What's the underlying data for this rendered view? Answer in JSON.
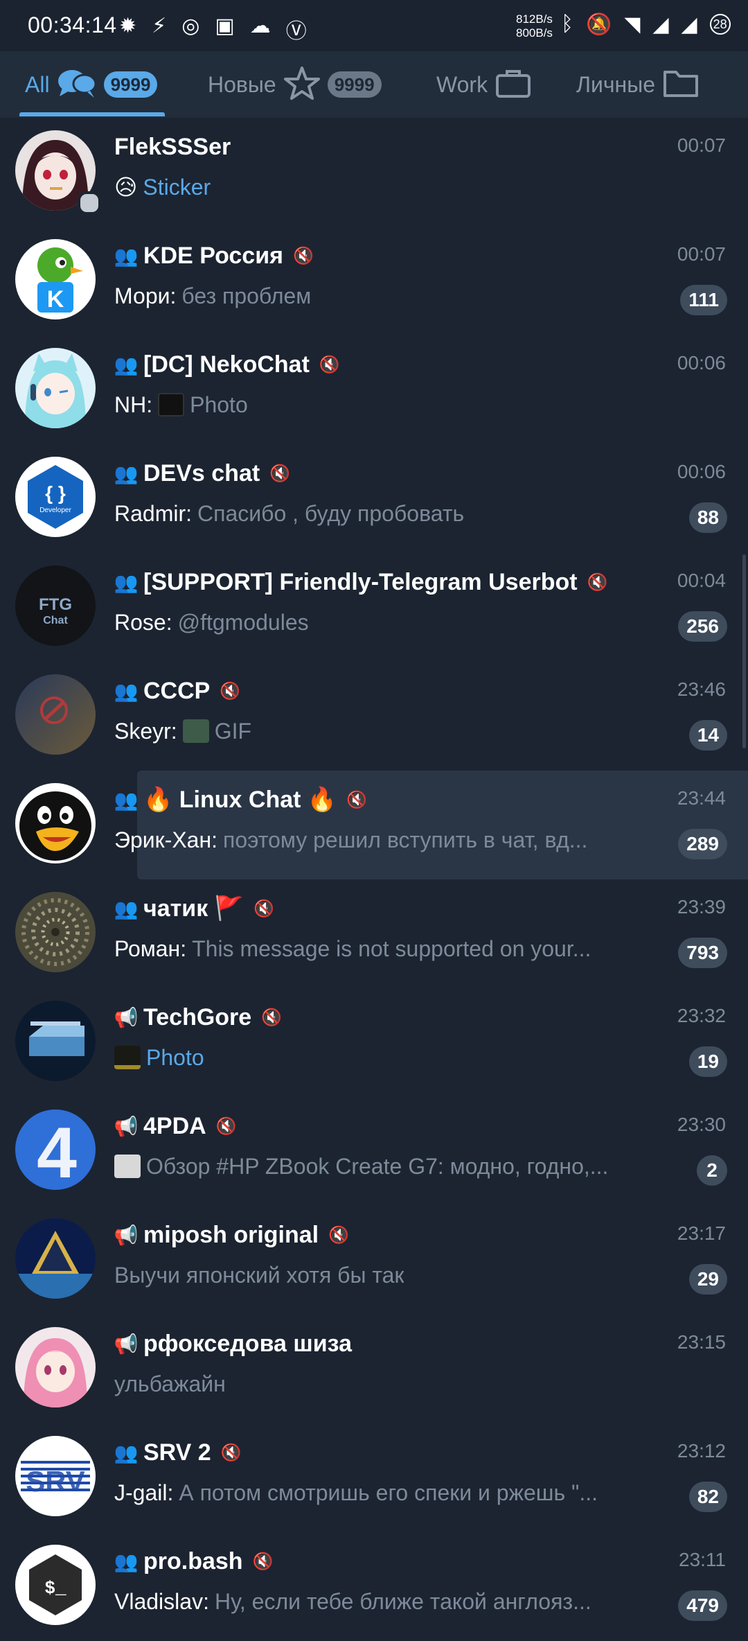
{
  "status_bar": {
    "time": "00:34:14",
    "left_icons": [
      "settings-gear-icon",
      "flash-icon",
      "aperture-icon",
      "image-icon",
      "cloud-icon",
      "vpn-icon"
    ],
    "net_speed_up": "812B/s",
    "net_speed_down": "800B/s",
    "right_icons": [
      "bluetooth-icon",
      "battery-small-icon",
      "mute-bell-icon",
      "wifi-icon",
      "signal-icon",
      "signal-icon",
      "battery-icon"
    ],
    "battery": "28"
  },
  "tabs": [
    {
      "label": "All",
      "icon": "chat-bubbles-icon",
      "badge": "9999",
      "active": true
    },
    {
      "label": "Новые",
      "icon": "star-icon",
      "badge": "9999",
      "active": false
    },
    {
      "label": "Work",
      "icon": "briefcase-icon",
      "badge": "",
      "active": false
    },
    {
      "label": "Личные",
      "icon": "folder-icon",
      "badge": "",
      "active": false
    }
  ],
  "chats": [
    {
      "title": "FlekSSSer",
      "type": "user",
      "muted": false,
      "time": "00:07",
      "sender": "",
      "emoji": "😥",
      "preview": "Sticker",
      "preview_accent": true,
      "badge": "",
      "online": true
    },
    {
      "title": "KDE Россия",
      "type": "group",
      "muted": true,
      "time": "00:07",
      "sender": "Мори:",
      "preview": "без проблем",
      "badge": "111"
    },
    {
      "title": "[DC] NekoChat",
      "type": "group",
      "muted": true,
      "time": "00:06",
      "sender": "NH:",
      "preview": "Photo",
      "thumb": true,
      "badge": ""
    },
    {
      "title": "DEVs chat",
      "type": "group",
      "muted": true,
      "time": "00:06",
      "sender": "Radmir:",
      "preview": "Спасибо , буду пробовать",
      "badge": "88"
    },
    {
      "title": "[SUPPORT] Friendly-Telegram Userbot",
      "type": "group",
      "muted": true,
      "time": "00:04",
      "sender": "Rose:",
      "preview": "@ftgmodules",
      "badge": "256"
    },
    {
      "title": "СССР",
      "type": "group",
      "muted": true,
      "time": "23:46",
      "sender": "Skeyr:",
      "preview": "GIF",
      "thumb": true,
      "badge": "14"
    },
    {
      "title": "🔥 Linux Chat 🔥",
      "type": "group",
      "muted": true,
      "time": "23:44",
      "sender": "Эрик-Хан:",
      "preview": "поэтому решил вступить в чат, вд...",
      "badge": "289",
      "highlight": true
    },
    {
      "title": "чатик 🚩",
      "type": "group",
      "muted": true,
      "time": "23:39",
      "sender": "Роман:",
      "preview": "This message is not supported on your...",
      "badge": "793"
    },
    {
      "title": "TechGore",
      "type": "channel",
      "muted": true,
      "time": "23:32",
      "sender": "",
      "preview": "Photo",
      "preview_accent": true,
      "thumb": true,
      "badge": "19"
    },
    {
      "title": "4PDA",
      "type": "channel",
      "muted": true,
      "time": "23:30",
      "sender": "",
      "preview": "Обзор #HP ZBook Create G7: модно, годно,...",
      "thumb": true,
      "badge": "2"
    },
    {
      "title": "miposh original",
      "type": "channel",
      "muted": true,
      "time": "23:17",
      "sender": "",
      "preview": "Выучи японский хотя бы так",
      "badge": "29"
    },
    {
      "title": "рфокседова шиза",
      "type": "channel",
      "muted": false,
      "time": "23:15",
      "sender": "",
      "preview": "ульбажайн",
      "badge": ""
    },
    {
      "title": "SRV 2",
      "type": "group",
      "muted": true,
      "time": "23:12",
      "sender": "J-gail:",
      "preview": "А потом смотришь его спеки и ржешь \"...",
      "badge": "82"
    },
    {
      "title": "pro.bash",
      "type": "group",
      "muted": true,
      "time": "23:11",
      "sender": "Vladislav:",
      "preview": "Ну, если тебе ближе такой англояз...",
      "badge": "479"
    }
  ],
  "avatar_labels": {
    "devs": "{ }",
    "devs_sub": "Developer",
    "ftg": "FTG",
    "ftg_sub": "Chat",
    "fourpda": "4",
    "srv": "SRV",
    "bash": "$_"
  }
}
